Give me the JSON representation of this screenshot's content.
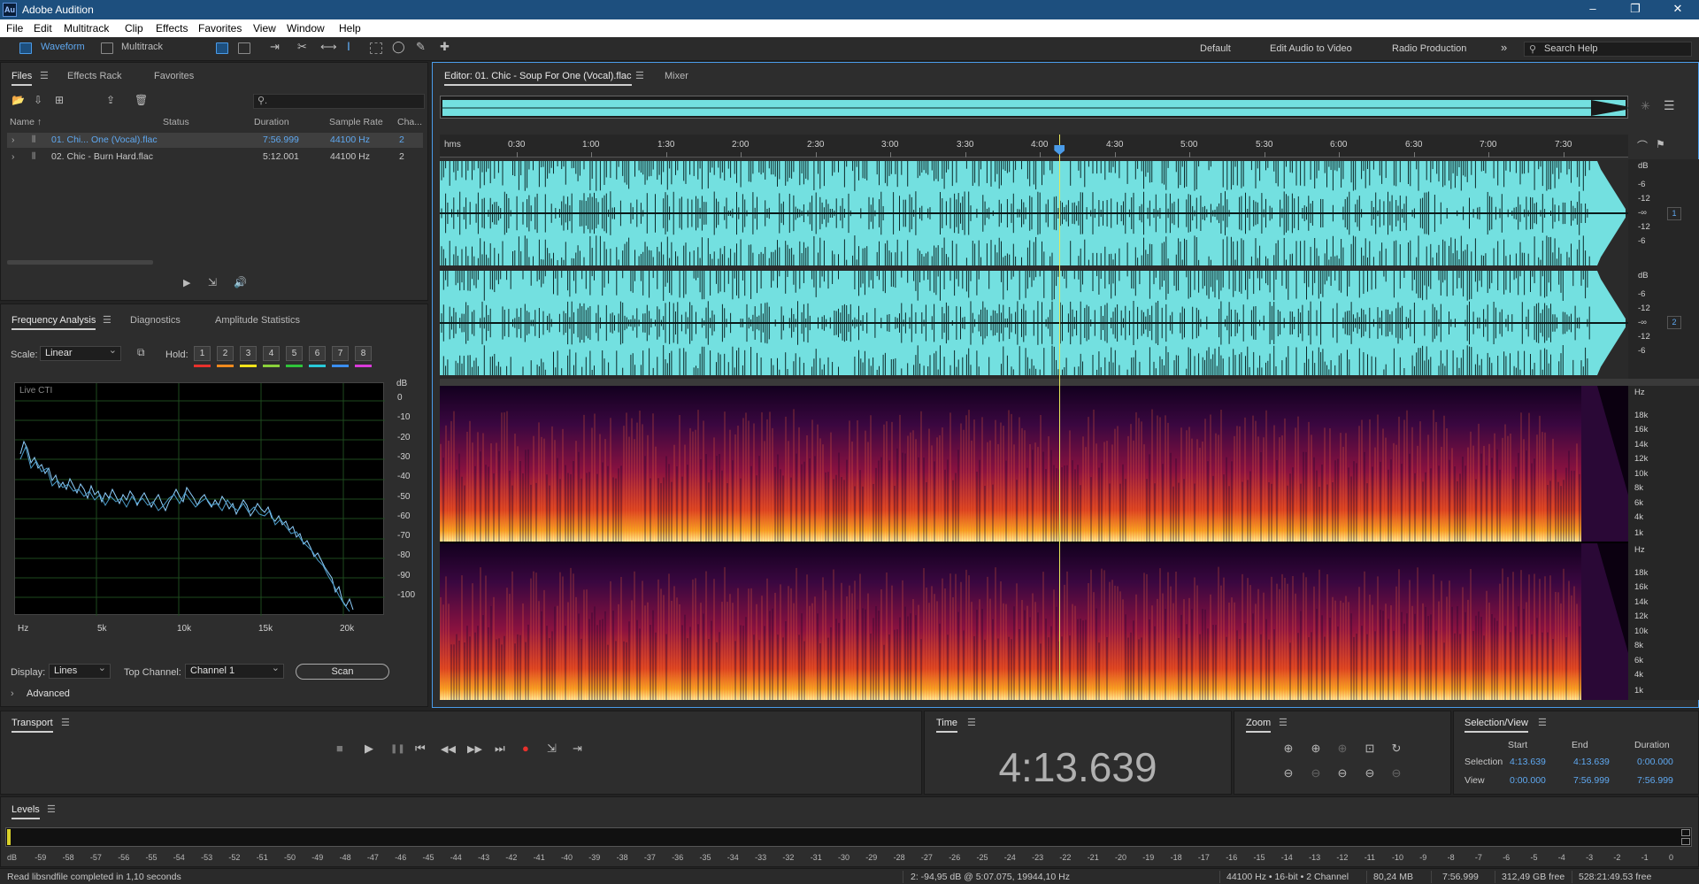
{
  "app": {
    "title": "Adobe Audition",
    "logo": "Au"
  },
  "window_controls": {
    "minimize": "–",
    "maximize": "❐",
    "close": "✕"
  },
  "menu": [
    "File",
    "Edit",
    "Multitrack",
    "Clip",
    "Effects",
    "Favorites",
    "View",
    "Window",
    "Help"
  ],
  "toolbar": {
    "waveform_label": "Waveform",
    "multitrack_label": "Multitrack",
    "workspaces": [
      "Default",
      "Edit Audio to Video",
      "Radio Production"
    ],
    "more": "»",
    "search_placeholder": "Search Help"
  },
  "files_panel": {
    "tabs": [
      "Files",
      "Effects Rack",
      "Favorites"
    ],
    "search_glyph": "⚲.",
    "columns": {
      "name": "Name ↑",
      "status": "Status",
      "duration": "Duration",
      "sample_rate": "Sample Rate",
      "channels": "Cha..."
    },
    "rows": [
      {
        "name": "01. Chi... One (Vocal).flac",
        "duration": "7:56.999",
        "sample_rate": "44100 Hz",
        "channels": "2",
        "selected": true
      },
      {
        "name": "02. Chic - Burn Hard.flac",
        "duration": "5:12.001",
        "sample_rate": "44100 Hz",
        "channels": "2",
        "selected": false
      }
    ]
  },
  "analysis_panel": {
    "tabs": [
      "Frequency Analysis",
      "Diagnostics",
      "Amplitude Statistics"
    ],
    "scale_label": "Scale:",
    "scale_value": "Linear",
    "hold_label": "Hold:",
    "hold_buttons": [
      "1",
      "2",
      "3",
      "4",
      "5",
      "6",
      "7",
      "8"
    ],
    "hold_colors": [
      "#e8312c",
      "#f08a1e",
      "#f2e31a",
      "#8ad13a",
      "#2fc43a",
      "#28c9d8",
      "#3a8ef0",
      "#d93ad9"
    ],
    "graph_label": "Live CTI",
    "y_unit": "dB",
    "y_ticks": [
      "0",
      "-10",
      "-20",
      "-30",
      "-40",
      "-50",
      "-60",
      "-70",
      "-80",
      "-90",
      "-100"
    ],
    "x_ticks": [
      "Hz",
      "5k",
      "10k",
      "15k",
      "20k"
    ],
    "display_label": "Display:",
    "display_value": "Lines",
    "top_channel_label": "Top Channel:",
    "top_channel_value": "Channel 1",
    "scan_label": "Scan",
    "advanced_label": "Advanced"
  },
  "editor": {
    "tab_label": "Editor: 01. Chic - Soup For One (Vocal).flac",
    "mixer_label": "Mixer",
    "time_ruler": [
      "hms",
      "0:30",
      "1:00",
      "1:30",
      "2:00",
      "2:30",
      "3:00",
      "3:30",
      "4:00",
      "4:30",
      "5:00",
      "5:30",
      "6:00",
      "6:30",
      "7:00",
      "7:30"
    ],
    "db_ticks_ch": [
      "dB",
      "-6",
      "-12",
      "-∞",
      "-12",
      "-6"
    ],
    "db_ticks_ch2": [
      "dB",
      "-6",
      "-12",
      "-∞",
      "-12",
      "-6"
    ],
    "channel_badges": [
      "1",
      "2"
    ],
    "hz_ticks": [
      "Hz",
      "18k",
      "16k",
      "14k",
      "12k",
      "10k",
      "8k",
      "6k",
      "4k",
      "1k"
    ],
    "waveform_color": "#73e0e0",
    "playhead_fraction": 0.5215
  },
  "transport": {
    "title": "Transport",
    "buttons": [
      "■",
      "▶",
      "❚❚",
      "⏮",
      "◀◀",
      "▶▶",
      "⏭",
      "●",
      "⇲",
      "⇥"
    ]
  },
  "time_panel": {
    "title": "Time",
    "value": "4:13.639"
  },
  "zoom_panel": {
    "title": "Zoom"
  },
  "selection_view": {
    "title": "Selection/View",
    "headers": [
      "Start",
      "End",
      "Duration"
    ],
    "rows": [
      {
        "label": "Selection",
        "start": "4:13.639",
        "end": "4:13.639",
        "duration": "0:00.000"
      },
      {
        "label": "View",
        "start": "0:00.000",
        "end": "7:56.999",
        "duration": "7:56.999"
      }
    ]
  },
  "levels": {
    "title": "Levels",
    "scale": [
      "dB",
      "-59",
      "-58",
      "-57",
      "-56",
      "-55",
      "-54",
      "-53",
      "-52",
      "-51",
      "-50",
      "-49",
      "-48",
      "-47",
      "-46",
      "-45",
      "-44",
      "-43",
      "-42",
      "-41",
      "-40",
      "-39",
      "-38",
      "-37",
      "-36",
      "-35",
      "-34",
      "-33",
      "-32",
      "-31",
      "-30",
      "-29",
      "-28",
      "-27",
      "-26",
      "-25",
      "-24",
      "-23",
      "-22",
      "-21",
      "-20",
      "-19",
      "-18",
      "-17",
      "-16",
      "-15",
      "-14",
      "-13",
      "-12",
      "-11",
      "-10",
      "-9",
      "-8",
      "-7",
      "-6",
      "-5",
      "-4",
      "-3",
      "-2",
      "-1",
      "0"
    ]
  },
  "status": {
    "message": "Read libsndfile completed in 1,10 seconds",
    "cursor": "2: -94,95 dB @ 5:07.075, 19944,10 Hz",
    "format": "44100 Hz • 16-bit • 2 Channel",
    "size": "80,24 MB",
    "duration": "7:56.999",
    "free_space": "312,49 GB free",
    "free_time": "528:21:49.53 free"
  }
}
